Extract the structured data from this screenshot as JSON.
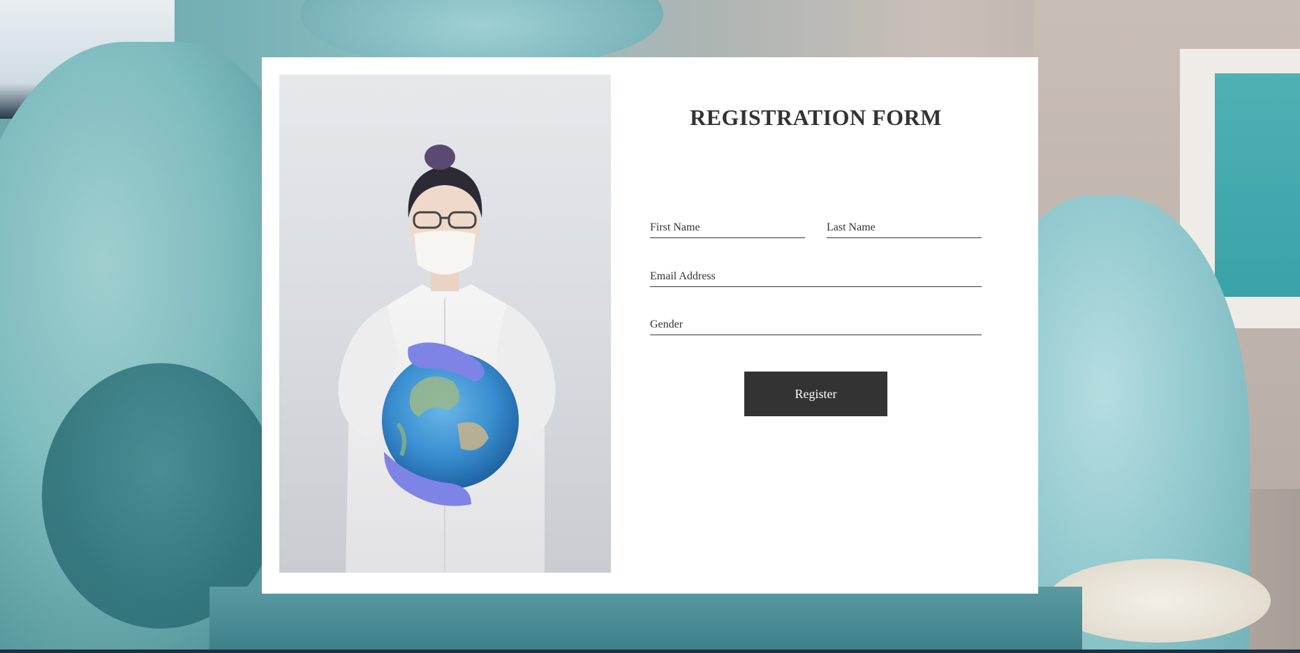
{
  "form": {
    "title": "REGISTRATION FORM",
    "fields": {
      "first_name": {
        "placeholder": "First Name",
        "value": ""
      },
      "last_name": {
        "placeholder": "Last Name",
        "value": ""
      },
      "email": {
        "placeholder": "Email Address",
        "value": ""
      },
      "gender": {
        "placeholder": "Gender",
        "value": ""
      }
    },
    "submit_label": "Register"
  },
  "colors": {
    "card_background": "#ffffff",
    "text": "#333333",
    "button_background": "#333333",
    "button_text": "#ffffff",
    "background_accent": "#76b1b6"
  },
  "images": {
    "side_photo": "doctor-with-globe",
    "background": "operating-room-surgeons"
  }
}
